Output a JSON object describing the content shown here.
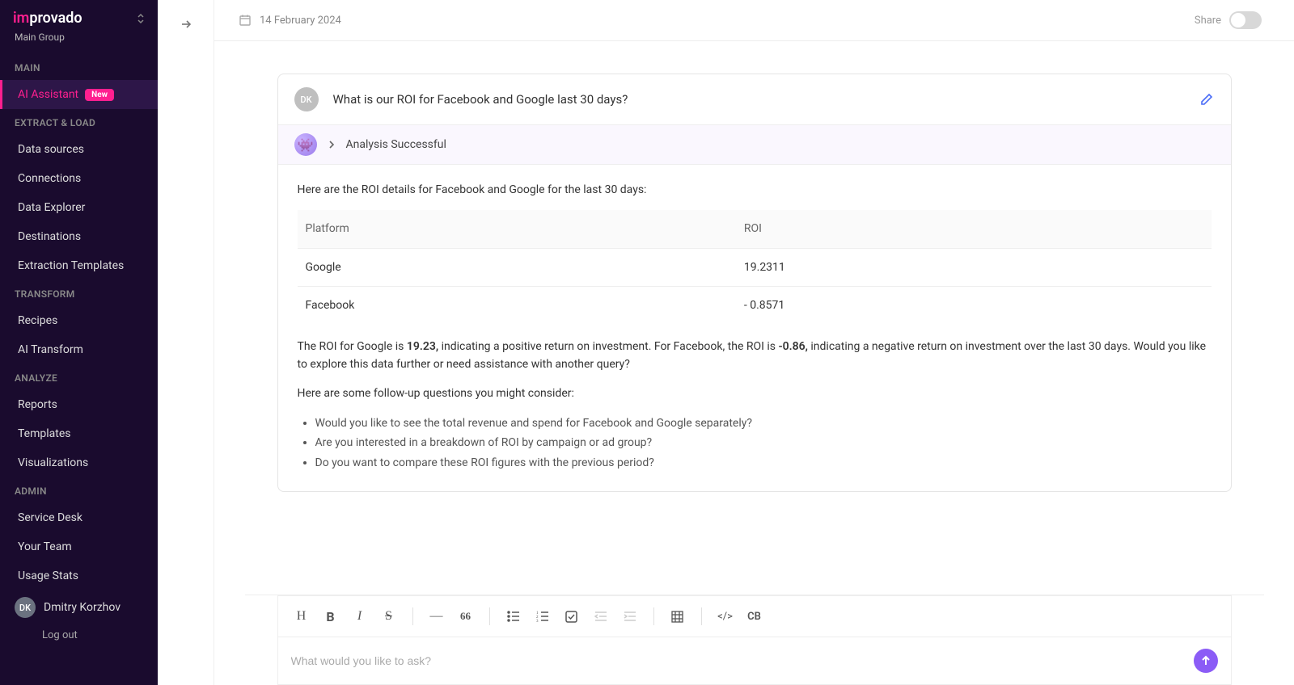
{
  "brand": {
    "im": "im",
    "provado": "provado"
  },
  "group": "Main Group",
  "sections": {
    "main": "MAIN",
    "extract": "EXTRACT & LOAD",
    "transform": "TRANSFORM",
    "analyze": "ANALYZE",
    "admin": "ADMIN"
  },
  "nav": {
    "ai_assistant": "AI Assistant",
    "new_badge": "New",
    "data_sources": "Data sources",
    "connections": "Connections",
    "data_explorer": "Data Explorer",
    "destinations": "Destinations",
    "extraction_templates": "Extraction Templates",
    "recipes": "Recipes",
    "ai_transform": "AI Transform",
    "reports": "Reports",
    "templates": "Templates",
    "visualizations": "Visualizations",
    "service_desk": "Service Desk",
    "your_team": "Your Team",
    "usage_stats": "Usage Stats"
  },
  "user": {
    "initials": "DK",
    "name": "Dmitry Korzhov",
    "logout": "Log out"
  },
  "topbar": {
    "date": "14 February 2024",
    "share": "Share"
  },
  "chat": {
    "q_initials": "DK",
    "question": "What is our ROI for Facebook and Google last 30 days?",
    "status": "Analysis Successful",
    "intro": "Here are the ROI details for Facebook and Google for the last 30 days:",
    "table": {
      "h1": "Platform",
      "h2": "ROI",
      "rows": [
        {
          "platform": "Google",
          "roi": "19.2311"
        },
        {
          "platform": "Facebook",
          "roi": "- 0.8571"
        }
      ]
    },
    "summary_pre": "The ROI for Google is ",
    "summary_g": "19.23,",
    "summary_mid": " indicating a positive return on investment. For Facebook, the ROI is ",
    "summary_f": "-0.86,",
    "summary_post": " indicating a negative return on investment over the last 30 days. Would you like to explore this data further or need assistance with another query?",
    "followup_intro": "Here are some follow-up questions you might consider:",
    "followups": [
      "Would you like to see the total revenue and spend for Facebook and Google separately?",
      "Are you interested in a breakdown of ROI by campaign or ad group?",
      "Do you want to compare these ROI figures with the previous period?"
    ]
  },
  "composer": {
    "placeholder": "What would you like to ask?",
    "cb": "CB",
    "quote": "66"
  }
}
